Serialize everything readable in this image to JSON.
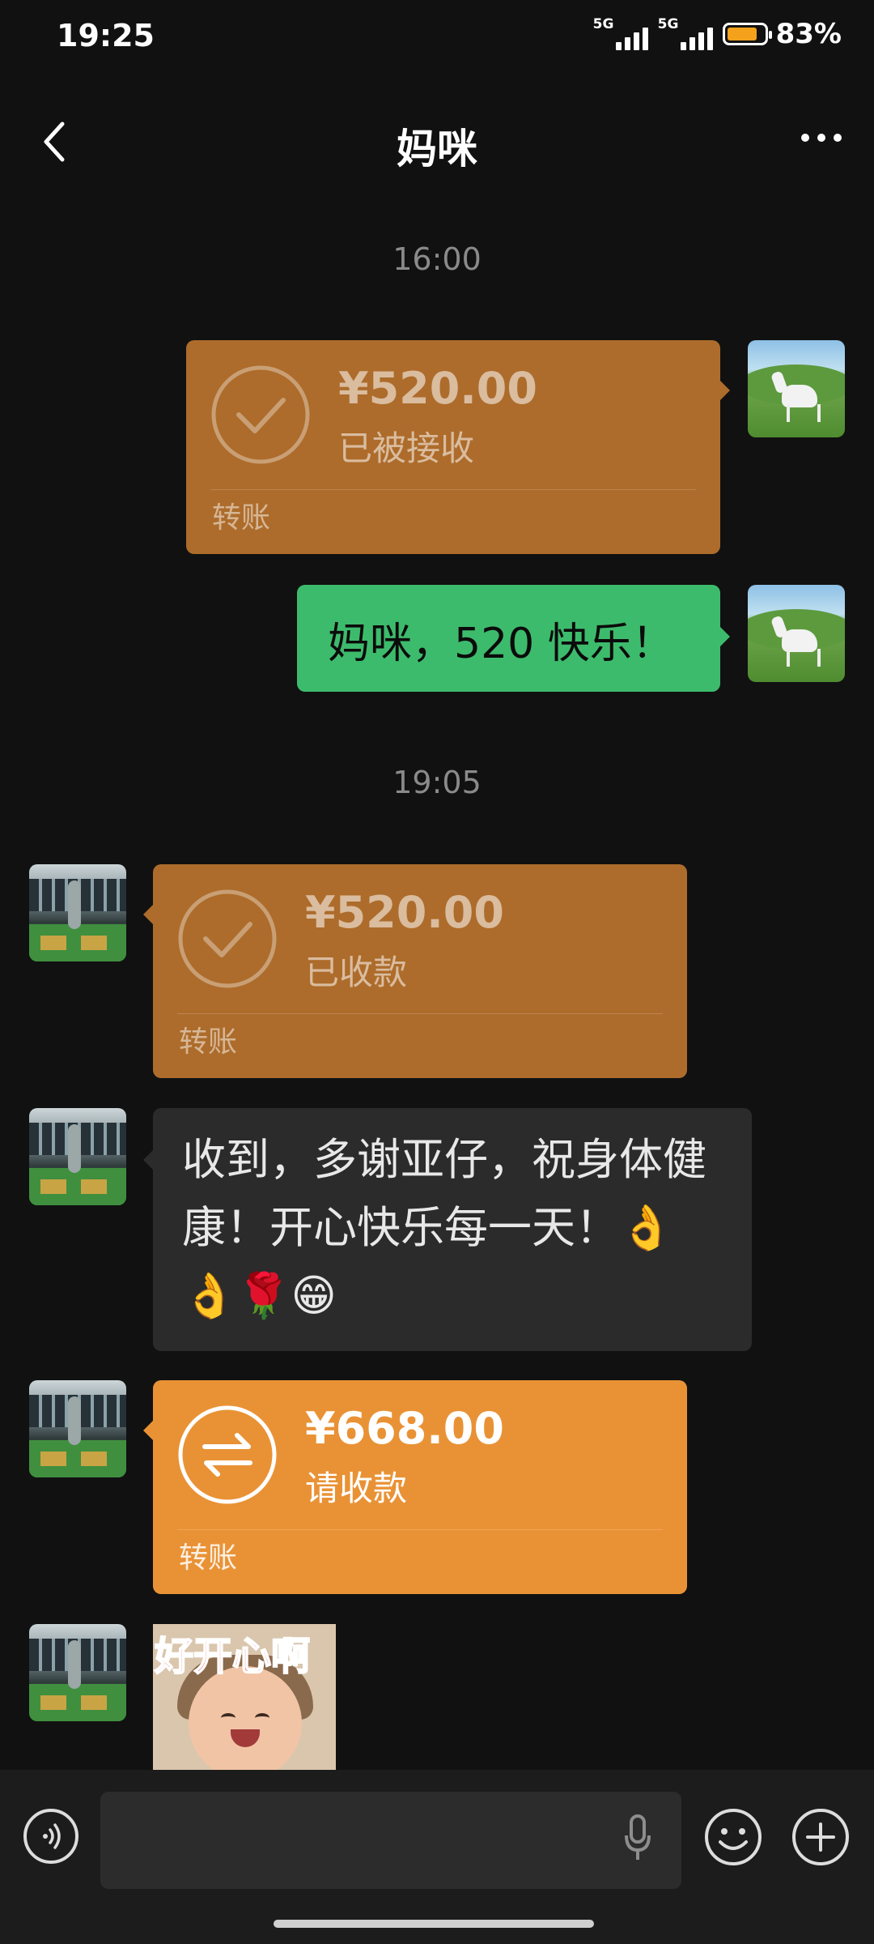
{
  "status_bar": {
    "time": "19:25",
    "network_1": "5G",
    "network_2": "5G",
    "battery_percent": "83%",
    "battery_level": 0.83,
    "battery_color": "#f4a21c"
  },
  "header": {
    "title": "妈咪",
    "back_icon": "chevron-left-icon",
    "more_icon": "more-dots-icon"
  },
  "messages": [
    {
      "type": "timestamp",
      "text": "16:00"
    },
    {
      "type": "transfer",
      "side": "right",
      "amount": "¥520.00",
      "status": "已被接收",
      "label": "转账",
      "state": "received"
    },
    {
      "type": "text",
      "side": "right",
      "text": "妈咪，520 快乐！"
    },
    {
      "type": "timestamp",
      "text": "19:05"
    },
    {
      "type": "transfer",
      "side": "left",
      "amount": "¥520.00",
      "status": "已收款",
      "label": "转账",
      "state": "received"
    },
    {
      "type": "text",
      "side": "left",
      "text": "收到，多谢亚仔，祝身体健康！开心快乐每一天！👌👌🌹😁"
    },
    {
      "type": "transfer",
      "side": "left",
      "amount": "¥668.00",
      "status": "请收款",
      "label": "转账",
      "state": "pending"
    },
    {
      "type": "sticker",
      "side": "left",
      "caption": "好开心啊"
    }
  ],
  "colors": {
    "transfer_received": "#ad6c2b",
    "transfer_pending": "#e99235",
    "my_bubble": "#3dbb6c",
    "their_bubble": "#2b2b2b",
    "background": "#111111"
  },
  "input_bar": {
    "voice_icon": "voice-mode-icon",
    "mic_icon": "microphone-icon",
    "emoji_icon": "emoji-icon",
    "plus_icon": "plus-icon"
  }
}
